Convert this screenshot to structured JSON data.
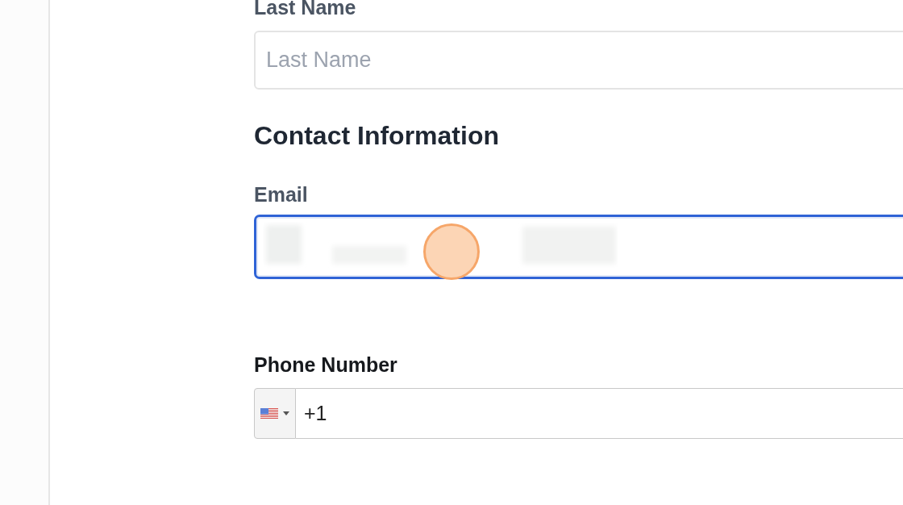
{
  "form": [
    {
      "kind": "text",
      "label": "Last Name",
      "placeholder": "Last Name",
      "focused": false
    },
    {
      "kind": "heading",
      "text": "Contact Information"
    },
    {
      "kind": "text",
      "label": "Email",
      "focused": true,
      "value_redacted": true,
      "click_marker": true
    },
    {
      "kind": "phone",
      "label": "Phone Number",
      "value": "+1"
    }
  ]
}
